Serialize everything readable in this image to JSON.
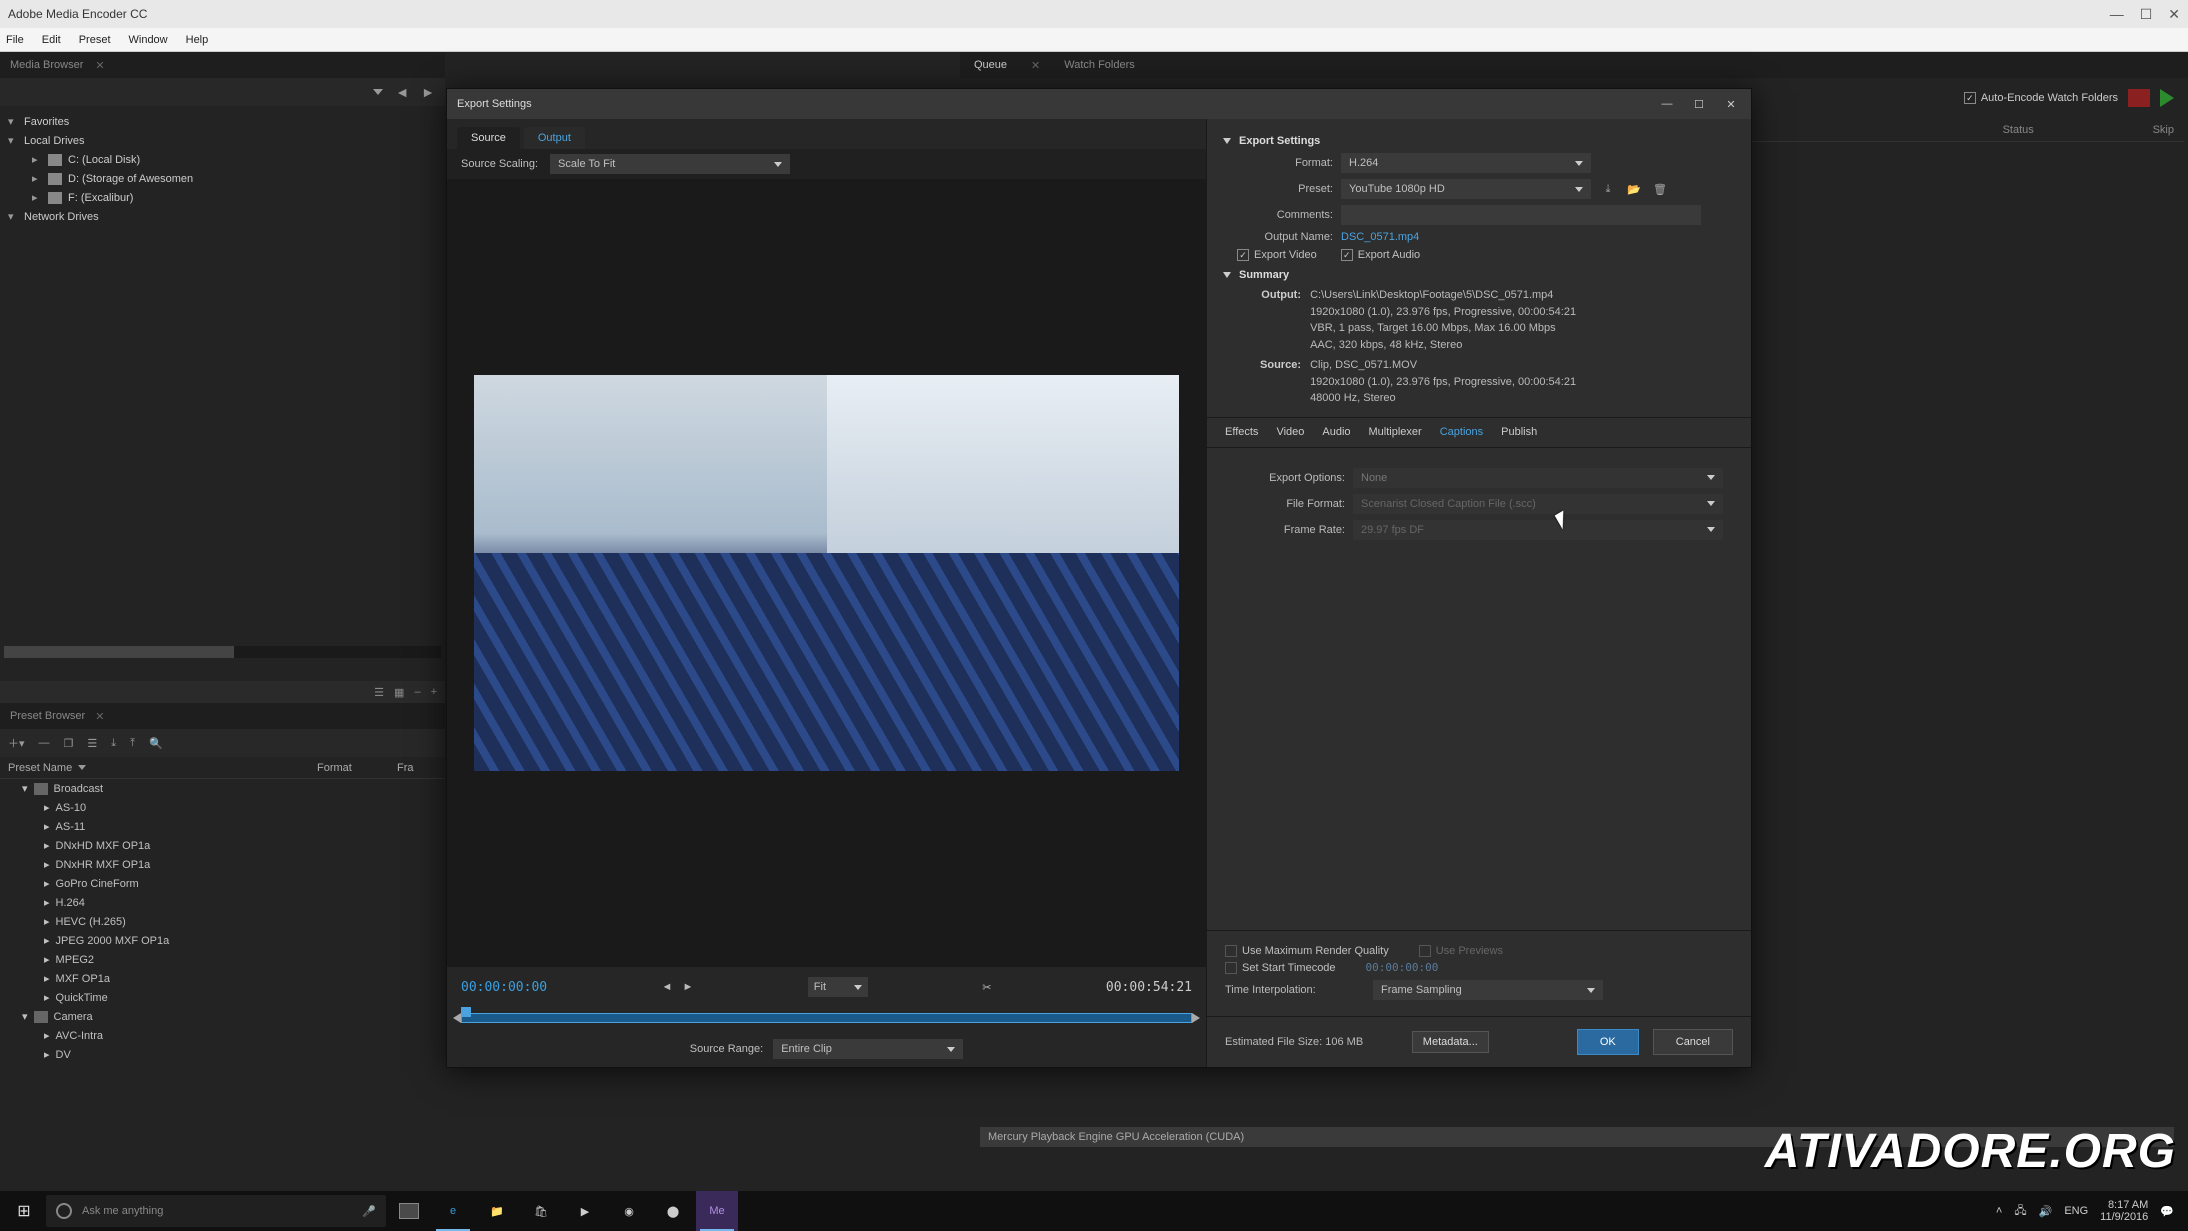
{
  "app": {
    "title": "Adobe Media Encoder CC"
  },
  "menubar": [
    "File",
    "Edit",
    "Preset",
    "Window",
    "Help"
  ],
  "window_ctrls": {
    "min": "—",
    "max": "☐",
    "close": "✕"
  },
  "media_browser": {
    "tab": "Media Browser",
    "favorites": "Favorites",
    "local_drives": "Local Drives",
    "drives": [
      "C: (Local Disk)",
      "D: (Storage of Awesomen",
      "F: (Excalibur)"
    ],
    "network_drives": "Network Drives"
  },
  "preset_browser": {
    "tab": "Preset Browser",
    "cols": {
      "name": "Preset Name",
      "format": "Format",
      "fra": "Fra"
    },
    "groups": [
      {
        "name": "Broadcast",
        "items": [
          "AS-10",
          "AS-11",
          "DNxHD MXF OP1a",
          "DNxHR MXF OP1a",
          "GoPro CineForm",
          "H.264",
          "HEVC (H.265)",
          "JPEG 2000 MXF OP1a",
          "MPEG2",
          "MXF OP1a",
          "QuickTime"
        ]
      },
      {
        "name": "Camera",
        "items": [
          "AVC-Intra",
          "DV"
        ]
      }
    ]
  },
  "center_tabs": {
    "queue": "Queue",
    "watch": "Watch Folders"
  },
  "auto_encode": "Auto-Encode Watch Folders",
  "cols_header": {
    "status": "Status",
    "skip": "Skip"
  },
  "playback": {
    "renderer": "Mercury Playback Engine GPU Acceleration (CUDA)"
  },
  "dialog": {
    "title": "Export Settings",
    "tabs": {
      "source": "Source",
      "output": "Output"
    },
    "scaling": {
      "label": "Source Scaling:",
      "value": "Scale To Fit"
    },
    "timecode": {
      "in": "00:00:00:00",
      "out": "00:00:54:21",
      "fit": "Fit"
    },
    "source_range": {
      "label": "Source Range:",
      "value": "Entire Clip"
    },
    "export_settings": {
      "heading": "Export Settings",
      "format": {
        "label": "Format:",
        "value": "H.264"
      },
      "preset": {
        "label": "Preset:",
        "value": "YouTube 1080p HD"
      },
      "comments": {
        "label": "Comments:",
        "value": ""
      },
      "output_name": {
        "label": "Output Name:",
        "value": "DSC_0571.mp4"
      },
      "export_video": "Export Video",
      "export_audio": "Export Audio"
    },
    "summary": {
      "heading": "Summary",
      "output_k": "Output:",
      "output_v": "C:\\Users\\Link\\Desktop\\Footage\\5\\DSC_0571.mp4\n1920x1080 (1.0), 23.976 fps, Progressive, 00:00:54:21\nVBR, 1 pass, Target 16.00 Mbps, Max 16.00 Mbps\nAAC, 320 kbps, 48 kHz, Stereo",
      "source_k": "Source:",
      "source_v": "Clip, DSC_0571.MOV\n1920x1080 (1.0), 23.976 fps, Progressive, 00:00:54:21\n48000 Hz, Stereo"
    },
    "settings_tabs": [
      "Effects",
      "Video",
      "Audio",
      "Multiplexer",
      "Captions",
      "Publish"
    ],
    "settings_active": 4,
    "captions": {
      "export_options": {
        "label": "Export Options:",
        "value": "None"
      },
      "file_format": {
        "label": "File Format:",
        "value": "Scenarist Closed Caption File (.scc)"
      },
      "frame_rate": {
        "label": "Frame Rate:",
        "value": "29.97 fps DF"
      }
    },
    "render": {
      "use_max": "Use Maximum Render Quality",
      "use_previews": "Use Previews",
      "set_start": "Set Start Timecode",
      "start_tc": "00:00:00:00",
      "time_interp": {
        "label": "Time Interpolation:",
        "value": "Frame Sampling"
      }
    },
    "estimated": {
      "label": "Estimated File Size:",
      "value": "106 MB"
    },
    "buttons": {
      "metadata": "Metadata...",
      "ok": "OK",
      "cancel": "Cancel"
    }
  },
  "watermark": "ATIVADORE.ORG",
  "taskbar": {
    "search_placeholder": "Ask me anything",
    "lang": "ENG",
    "time": "8:17 AM",
    "date": "11/9/2016"
  }
}
